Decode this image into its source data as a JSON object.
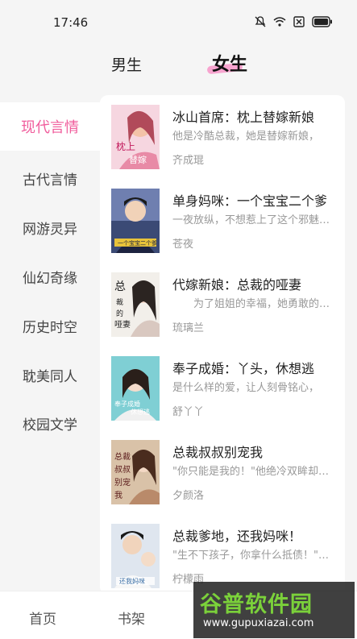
{
  "status": {
    "time": "17:46"
  },
  "gender_tabs": {
    "male": "男生",
    "female": "女生"
  },
  "categories": [
    {
      "label": "现代言情",
      "active": true
    },
    {
      "label": "古代言情",
      "active": false
    },
    {
      "label": "网游灵异",
      "active": false
    },
    {
      "label": "仙幻奇缘",
      "active": false
    },
    {
      "label": "历史时空",
      "active": false
    },
    {
      "label": "耽美同人",
      "active": false
    },
    {
      "label": "校园文学",
      "active": false
    }
  ],
  "books": [
    {
      "title": "冰山首席：枕上替嫁新娘",
      "desc": "他是冷酷总裁，她是替嫁新娘，",
      "author": "齐成琨",
      "cover_color": "#f3c7d4"
    },
    {
      "title": "单身妈咪：一个宝宝二个爹",
      "desc": "一夜放纵，不想惹上了这个邪魅…",
      "author": "苍夜",
      "cover_color": "#4a5a8a"
    },
    {
      "title": "代嫁新娘：总裁的哑妻",
      "desc": "为了姐姐的幸福，她勇敢的…",
      "author": "琉璃兰",
      "cover_color": "#e8e4e0"
    },
    {
      "title": "奉子成婚：丫头，休想逃",
      "desc": "是什么样的爱，让人刻骨铭心，",
      "author": "舒丫丫",
      "cover_color": "#6fc3c8"
    },
    {
      "title": "总裁叔叔别宠我",
      "desc": "\"你只能是我的！\"他绝冷双眸却…",
      "author": "夕颜洛",
      "cover_color": "#c9a88a"
    },
    {
      "title": "总裁爹地，还我妈咪！",
      "desc": "\"生不下孩子，你拿什么抵债！\"…",
      "author": "柠檬雨",
      "cover_color": "#cfd8e6"
    }
  ],
  "bottom_nav": {
    "home": "首页",
    "shelf": "书架"
  },
  "watermark": {
    "name": "谷普软件园",
    "url": "www.gupuxiazai.com"
  },
  "colors": {
    "accent": "#f05d9c",
    "tab_highlight": "#f7a4cf"
  }
}
